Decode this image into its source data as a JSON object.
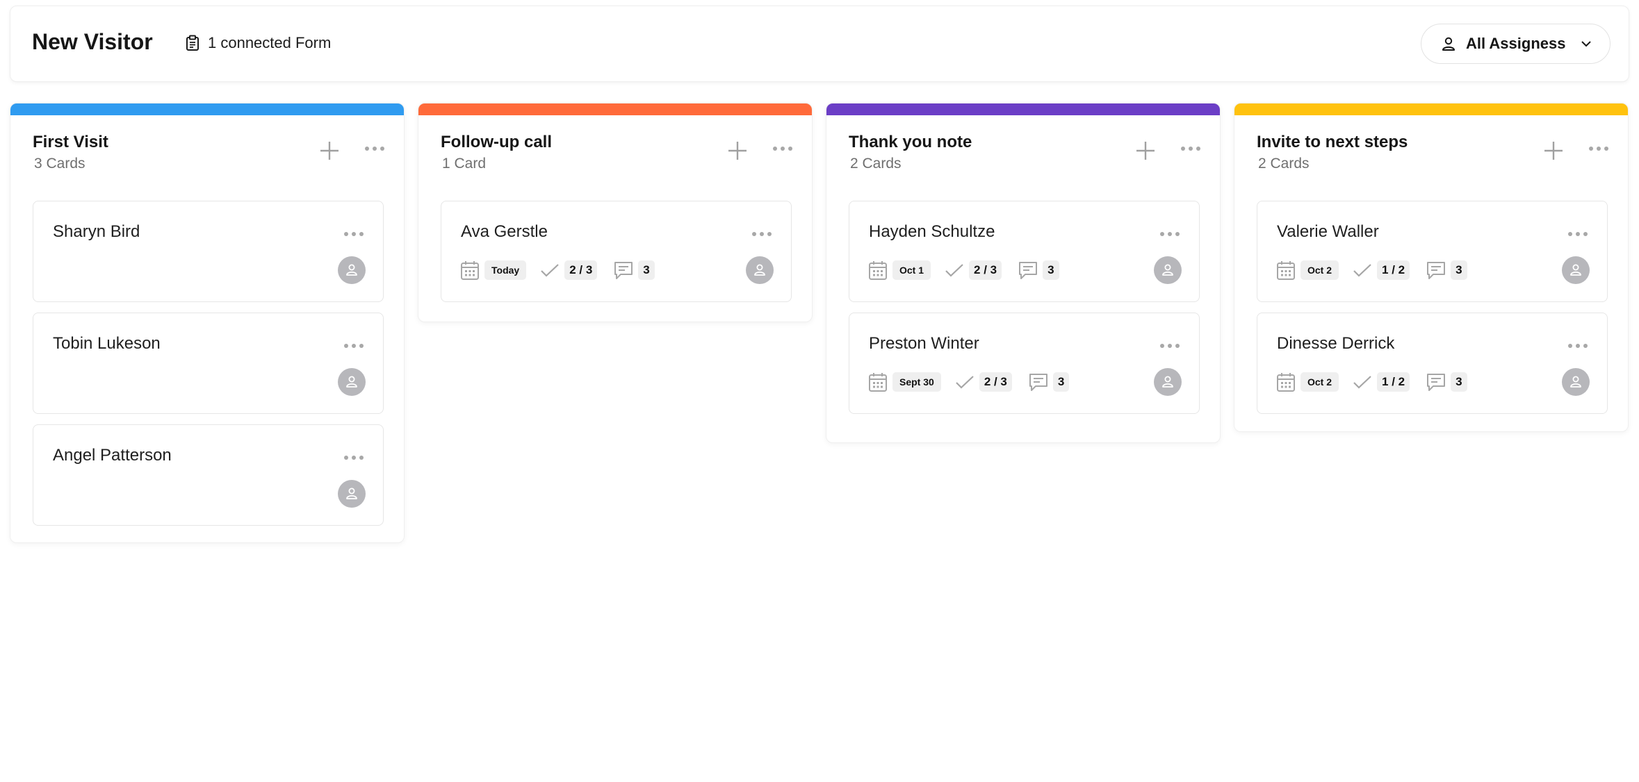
{
  "header": {
    "title": "New Visitor",
    "forms_label": "1 connected Form",
    "assignees_label": "All Assigness"
  },
  "colors": {
    "blue": "#2f9bf0",
    "orange": "#ff6a3a",
    "purple": "#6b3ec6",
    "yellow": "#ffc20e"
  },
  "columns": [
    {
      "title": "First Visit",
      "count": "3 Cards",
      "cards": [
        {
          "name": "Sharyn Bird"
        },
        {
          "name": "Tobin Lukeson"
        },
        {
          "name": "Angel Patterson"
        }
      ]
    },
    {
      "title": "Follow-up call",
      "count": "1 Card",
      "cards": [
        {
          "name": "Ava Gerstle",
          "date": "Today",
          "tasks": "2 / 3",
          "comments": "3"
        }
      ]
    },
    {
      "title": "Thank you note",
      "count": "2 Cards",
      "cards": [
        {
          "name": "Hayden Schultze",
          "date": "Oct 1",
          "tasks": "2 / 3",
          "comments": "3"
        },
        {
          "name": "Preston Winter",
          "date": "Sept 30",
          "tasks": "2 / 3",
          "comments": "3"
        }
      ]
    },
    {
      "title": "Invite to next steps",
      "count": "2 Cards",
      "cards": [
        {
          "name": "Valerie Waller",
          "date": "Oct 2",
          "tasks": "1 / 2",
          "comments": "3"
        },
        {
          "name": "Dinesse Derrick",
          "date": "Oct 2",
          "tasks": "1 / 2",
          "comments": "3"
        }
      ]
    }
  ]
}
